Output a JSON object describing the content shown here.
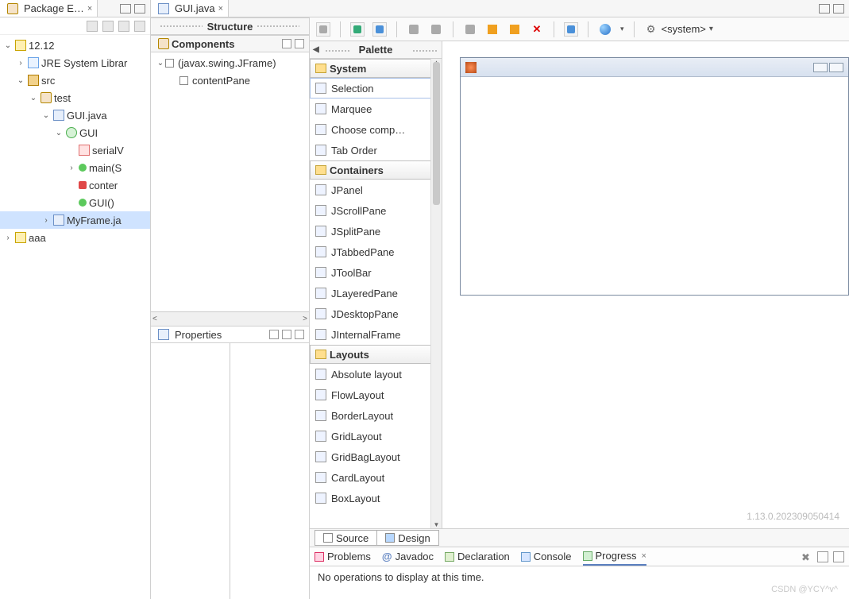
{
  "top": {
    "pkgExplorerTab": "Package E…",
    "editorTab": "GUI.java"
  },
  "packageExplorer": {
    "nodes": [
      {
        "depth": 0,
        "twist": "v",
        "icon": "proj",
        "label": "12.12"
      },
      {
        "depth": 1,
        "twist": ">",
        "icon": "lib",
        "label": "JRE System Librar"
      },
      {
        "depth": 1,
        "twist": "v",
        "icon": "src",
        "label": "src"
      },
      {
        "depth": 2,
        "twist": "v",
        "icon": "pkg",
        "label": "test"
      },
      {
        "depth": 3,
        "twist": "v",
        "icon": "java",
        "label": "GUI.java"
      },
      {
        "depth": 4,
        "twist": "v",
        "icon": "type",
        "label": "GUI"
      },
      {
        "depth": 5,
        "twist": "",
        "icon": "field",
        "label": "serialV"
      },
      {
        "depth": 5,
        "twist": ">",
        "icon": "method",
        "label": "main(S"
      },
      {
        "depth": 5,
        "twist": "",
        "icon": "methodred",
        "label": "conter"
      },
      {
        "depth": 5,
        "twist": "",
        "icon": "method",
        "label": "GUI()"
      },
      {
        "depth": 3,
        "twist": ">",
        "icon": "java",
        "label": "MyFrame.ja",
        "selected": true
      },
      {
        "depth": 0,
        "twist": ">",
        "icon": "proj",
        "label": "aaa"
      }
    ]
  },
  "structure": {
    "title": "Structure",
    "componentsTitle": "Components",
    "rows": [
      {
        "depth": 0,
        "twist": "v",
        "label": "(javax.swing.JFrame)"
      },
      {
        "depth": 1,
        "twist": "",
        "label": "contentPane"
      }
    ],
    "propertiesTitle": "Properties"
  },
  "toolbar": {
    "systemLabel": "<system>"
  },
  "palette": {
    "title": "Palette",
    "groups": [
      {
        "name": "System",
        "items": [
          {
            "label": "Selection",
            "selected": true
          },
          {
            "label": "Marquee"
          },
          {
            "label": "Choose comp…"
          },
          {
            "label": "Tab Order"
          }
        ]
      },
      {
        "name": "Containers",
        "items": [
          {
            "label": "JPanel"
          },
          {
            "label": "JScrollPane"
          },
          {
            "label": "JSplitPane"
          },
          {
            "label": "JTabbedPane"
          },
          {
            "label": "JToolBar"
          },
          {
            "label": "JLayeredPane"
          },
          {
            "label": "JDesktopPane"
          },
          {
            "label": "JInternalFrame"
          }
        ]
      },
      {
        "name": "Layouts",
        "items": [
          {
            "label": "Absolute layout"
          },
          {
            "label": "FlowLayout"
          },
          {
            "label": "BorderLayout"
          },
          {
            "label": "GridLayout"
          },
          {
            "label": "GridBagLayout"
          },
          {
            "label": "CardLayout"
          },
          {
            "label": "BoxLayout"
          }
        ]
      }
    ]
  },
  "designerTabs": {
    "source": "Source",
    "design": "Design"
  },
  "bottomTabs": {
    "problems": "Problems",
    "javadoc": "Javadoc",
    "declaration": "Declaration",
    "console": "Console",
    "progress": "Progress"
  },
  "progressMsg": "No operations to display at this time.",
  "versionText": "1.13.0.202309050414",
  "watermark": "CSDN @YCY^v^"
}
